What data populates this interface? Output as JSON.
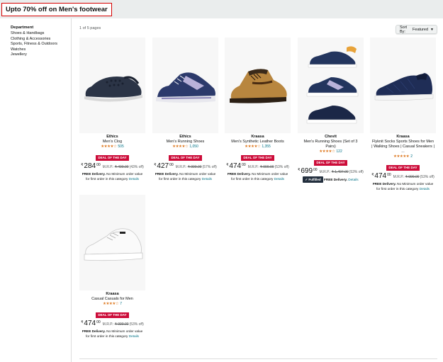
{
  "promo": {
    "title": "Upto 70% off on Men's footwear"
  },
  "sidebar": {
    "heading": "Department",
    "items": [
      "Shoes & Handbags",
      "Clothing & Accessories",
      "Sports, Fitness & Outdoors",
      "Watches",
      "Jewellery"
    ]
  },
  "results": {
    "pages_text": "1 of 5 pages",
    "sort_label": "Sort By:",
    "sort_value": "Featured"
  },
  "products": [
    {
      "brand": "Ethics",
      "name": "Men's Clog",
      "stars": "★★★★☆",
      "rating_count": "505",
      "deal": "DEAL OF THE DAY",
      "currency": "₹",
      "whole": "284",
      "frac": "00",
      "mrp_label": "M.R.P.:",
      "mrp": "₹ 499.00",
      "discount": "(43% off)",
      "delivery_label": "FREE Delivery.",
      "delivery_text": "No Minimum order value for first order in this category",
      "details": "Details"
    },
    {
      "brand": "Ethics",
      "name": "Men's Running Shoes",
      "stars": "★★★★☆",
      "rating_count": "1,050",
      "deal": "DEAL OF THE DAY",
      "currency": "₹",
      "whole": "427",
      "frac": "00",
      "mrp_label": "M.R.P.:",
      "mrp": "₹ 999.00",
      "discount": "(57% off)",
      "delivery_label": "FREE Delivery.",
      "delivery_text": "No Minimum order value for first order in this category",
      "details": "Details"
    },
    {
      "brand": "Kraasa",
      "name": "Men's Synthetic Leather Boots",
      "stars": "★★★★☆",
      "rating_count": "1,355",
      "deal": "DEAL OF THE DAY",
      "currency": "₹",
      "whole": "474",
      "frac": "00",
      "mrp_label": "M.R.P.:",
      "mrp": "₹ 999.00",
      "discount": "(53% off)",
      "delivery_label": "FREE Delivery.",
      "delivery_text": "No Minimum order value for first order in this category",
      "details": "Details"
    },
    {
      "brand": "Chevit",
      "name": "Men's Running Shoes (Set of 3 Pairs)",
      "stars": "★★★★☆",
      "rating_count": "122",
      "deal": "DEAL OF THE DAY",
      "currency": "₹",
      "whole": "699",
      "frac": "00",
      "mrp_label": "M.R.P.:",
      "mrp": "₹ 1,497.00",
      "discount": "(53% off)",
      "fulfilled": "Fulfilled",
      "delivery_label": "FREE Delivery.",
      "details": "Details"
    },
    {
      "brand": "Kraasa",
      "name": "Flyknit Socks Sports Shoes for Men | Walking Shoes | Casual Sneakers | ...",
      "stars": "★★★★★",
      "rating_count": "2",
      "deal": "DEAL OF THE DAY",
      "currency": "₹",
      "whole": "474",
      "frac": "00",
      "mrp_label": "M.R.P.:",
      "mrp": "₹ 999.00",
      "discount": "(53% off)",
      "delivery_label": "FREE Delivery.",
      "delivery_text": "No Minimum order value for first order in this category",
      "details": "Details"
    },
    {
      "brand": "Kraasa",
      "name": "Casual Casuals for Men",
      "stars": "★★★★☆",
      "rating_count": "7",
      "deal": "DEAL OF THE DAY",
      "currency": "₹",
      "whole": "474",
      "frac": "00",
      "mrp_label": "M.R.P.:",
      "mrp": "₹ 999.00",
      "discount": "(53% off)",
      "delivery_label": "FREE Delivery.",
      "delivery_text": "No Minimum order value for first order in this category",
      "details": "Details"
    }
  ]
}
